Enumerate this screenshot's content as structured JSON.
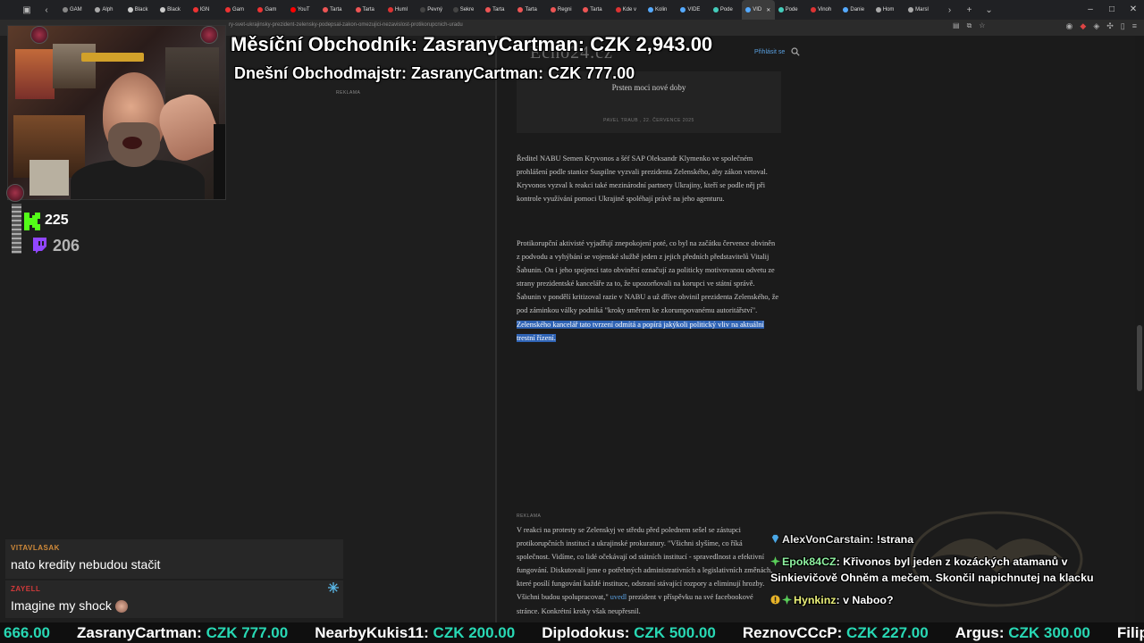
{
  "browser": {
    "tabs": [
      {
        "label": "GAM",
        "color": "#888"
      },
      {
        "label": "Alph",
        "color": "#aaa"
      },
      {
        "label": "Black",
        "color": "#ccc"
      },
      {
        "label": "Black",
        "color": "#ccc"
      },
      {
        "label": "IGN",
        "color": "#e33"
      },
      {
        "label": "Gam",
        "color": "#e33"
      },
      {
        "label": "Gam",
        "color": "#e33"
      },
      {
        "label": "YouT",
        "color": "#f00"
      },
      {
        "label": "Tarta",
        "color": "#e55"
      },
      {
        "label": "Tarta",
        "color": "#e55"
      },
      {
        "label": "Huml",
        "color": "#d33"
      },
      {
        "label": "Pevný",
        "color": "#444"
      },
      {
        "label": "Sekre",
        "color": "#444"
      },
      {
        "label": "Tarta",
        "color": "#e55"
      },
      {
        "label": "Tarta",
        "color": "#e55"
      },
      {
        "label": "Regni",
        "color": "#e55"
      },
      {
        "label": "Tarta",
        "color": "#e55"
      },
      {
        "label": "Kde v",
        "color": "#d33"
      },
      {
        "label": "Kolin",
        "color": "#5af"
      },
      {
        "label": "VIDE",
        "color": "#5af"
      },
      {
        "label": "Pode",
        "color": "#4cb"
      },
      {
        "label": "VID",
        "color": "#5af",
        "active": true
      },
      {
        "label": "Pode",
        "color": "#4cb"
      },
      {
        "label": "Vinoh",
        "color": "#d33"
      },
      {
        "label": "Danie",
        "color": "#5af"
      },
      {
        "label": "Hom",
        "color": "#aaa"
      },
      {
        "label": "Marsl",
        "color": "#aaa"
      }
    ],
    "url": "ry-svet-ukrajinsky-prezident-zelensky-podepsal-zakon-omezujici-nezavislost-protikorupcnich-uradu"
  },
  "page": {
    "logo": "Echo24.cz",
    "login": "Přihlásit se",
    "reklama": "REKLAMA",
    "teaser": {
      "title": "Prsten moci nové doby",
      "meta": "PAVEL TRAUB , 22. ČERVENCE 2025"
    },
    "para1": "Ředitel NABU Semen Kryvonos a šéf SAP Oleksandr Klymenko ve společném prohlášení podle stanice Suspilne vyzvali prezidenta Zelenského, aby zákon vetoval. Kryvonos vyzval k reakci také mezinárodní partnery Ukrajiny, kteří se podle něj při kontrole využívání pomoci Ukrajině spoléhají právě na jeho agenturu.",
    "para2_plain": "Protikorupční aktivisté vyjadřují znepokojení poté, co byl na začátku července obviněn z podvodu a vyhýbání se vojenské službě jeden z jejich předních představitelů Vitalij Šabunin. On i jeho spojenci tato obvinění označují za politicky motivovanou odvetu ze strany prezidentské kanceláře za to, že upozorňovali na korupci ve státní správě. Šabunin v pondělí kritizoval razie v NABU a už dříve obvinil prezidenta Zelenského, že pod záminkou války podniká \"kroky směrem ke zkorumpovanému autoritářství\". ",
    "para2_highlight": "Zelenského kancelář tato tvrzení odmítá a popírá jakýkoli politický vliv na aktuální trestní řízení.",
    "para3_a": "V reakci na protesty se Zelenskyj ve středu před polednem sešel se zástupci protikorupčních institucí a ukrajinské prokuratury. \"Všichni slyšíme, co říká společnost. Vidíme, co lidé očekávají od státních institucí - spravedlnost a efektivní fungování. Diskutovali jsme o potřebných administrativních a legislativních změnách, které posílí fungování každé instituce, odstraní stávající rozpory a eliminují hrozby. Všichni budou spolupracovat,\" ",
    "para3_link": "uvedl",
    "para3_b": " prezident v příspěvku na své facebookové stránce. Konkrétní kroky však neupřesnil."
  },
  "overlay": {
    "monthly": "Měsíční Obchodník: ZasranyCartman: CZK 2,943.00",
    "daily": "Dnešní Obchodmajstr: ZasranyCartman: CZK 777.00",
    "kick_viewers": "225",
    "twitch_viewers": "206",
    "kick_color": "#53fc18",
    "twitch_color": "#9146ff",
    "alerts": [
      {
        "user": "VITAVLASAK",
        "user_color": "#d08a3a",
        "message": "nato kredity nebudou stačit"
      },
      {
        "user": "ZAYELL",
        "user_color": "#d23a3a",
        "message": "Imagine my shock"
      }
    ],
    "chat": [
      {
        "icon": "gem-icon",
        "user": "AlexVonCarstain",
        "color": "#e6e6e6",
        "message": "!strana"
      },
      {
        "icon": "sparkle-icon",
        "user": "Epok84CZ",
        "color": "#8ef0a0",
        "message": "Křivonos byl jeden z kozáckých atamanů v",
        "message2": "Sinkievičově Ohněm a mečem. Skončil napichnutej na klacku"
      },
      {
        "icon": "badge-icon",
        "user": "Hynkinz",
        "color": "#eaf07a",
        "message": "v Naboo?"
      }
    ],
    "ticker": [
      {
        "name": "",
        "amount": "666.00"
      },
      {
        "name": "ZasranyCartman:",
        "amount": "CZK 777.00"
      },
      {
        "name": "NearbyKukis11:",
        "amount": "CZK 200.00"
      },
      {
        "name": "Diplodokus:",
        "amount": "CZK 500.00"
      },
      {
        "name": "ReznovCCcP:",
        "amount": "CZK 227.00"
      },
      {
        "name": "Argus:",
        "amount": "CZK 300.00"
      },
      {
        "name": "Filip",
        "amount": ""
      }
    ]
  }
}
